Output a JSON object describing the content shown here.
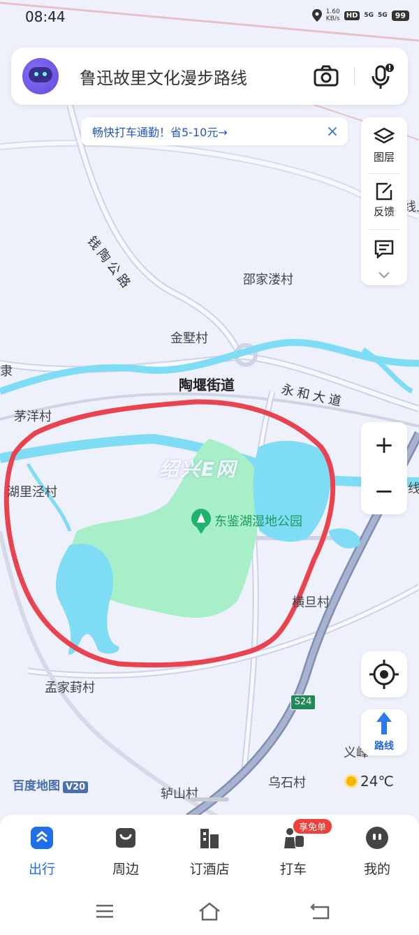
{
  "status_bar": {
    "time": "08:44",
    "speed_value": "1.60",
    "speed_unit": "KB/s",
    "hd": "HD",
    "net1": "5G",
    "net2": "5G",
    "battery": "99"
  },
  "search": {
    "text": "鲁迅故里文化漫步路线"
  },
  "promo": {
    "text": "畅快打车通勤！省5-10元→",
    "close": "×"
  },
  "tools": {
    "layers": "图层",
    "feedback": "反馈"
  },
  "zoom": {
    "in": "+",
    "out": "−"
  },
  "map": {
    "labels": {
      "road_qiantao": "钱陶公路",
      "shaojialoucun": "邵家溇村",
      "jinshucun": "金墅村",
      "taoyanjiedao": "陶堰街道",
      "yonghedadao": "永和大道",
      "maoyangcun": "茅洋村",
      "hulijingcun": "湖里泾村",
      "park": "东鉴湖湿地公园",
      "hengdancun": "横旦村",
      "mengjiacuncun": "孟家葑村",
      "yifeng": "义峰",
      "wushicun": "乌石村",
      "lushancun": "轳山村",
      "edge_left": "隶",
      "edge_right1": "线上",
      "edge_right2": "线"
    },
    "road_badge": "S24",
    "watermark": "绍兴E网",
    "colors": {
      "water": "#7fdcf5",
      "park": "#a6efc9",
      "highlight": "#e8434e",
      "background": "#eef0fb"
    }
  },
  "route_button": {
    "label": "路线"
  },
  "logo": {
    "text": "百度地图",
    "version": "V20"
  },
  "weather": {
    "temp": "24℃"
  },
  "bottom_nav": {
    "items": [
      "出行",
      "周边",
      "订酒店",
      "打车",
      "我的"
    ],
    "taxi_badge": "享免单"
  }
}
